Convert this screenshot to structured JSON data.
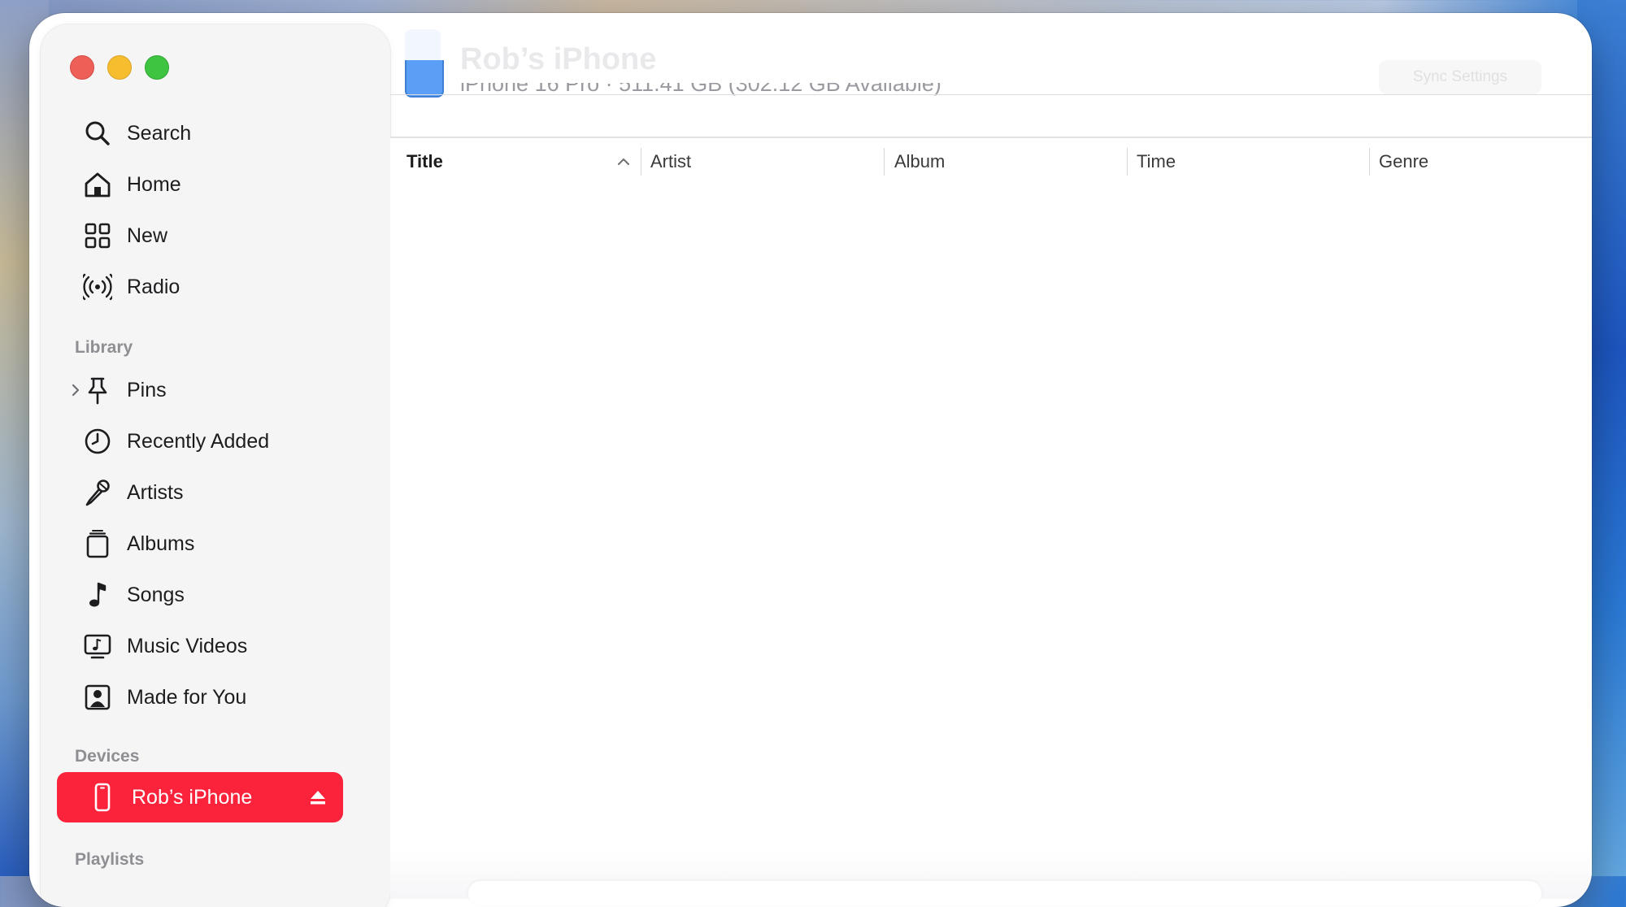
{
  "window": {
    "traffic_lights": [
      "close",
      "minimize",
      "zoom"
    ]
  },
  "sidebar": {
    "nav": [
      {
        "label": "Search",
        "icon": "search-icon"
      },
      {
        "label": "Home",
        "icon": "home-icon"
      },
      {
        "label": "New",
        "icon": "grid-icon"
      },
      {
        "label": "Radio",
        "icon": "radio-icon"
      }
    ],
    "library_title": "Library",
    "library": [
      {
        "label": "Pins",
        "icon": "pin-icon"
      },
      {
        "label": "Recently Added",
        "icon": "clock-icon"
      },
      {
        "label": "Artists",
        "icon": "microphone-icon"
      },
      {
        "label": "Albums",
        "icon": "album-icon"
      },
      {
        "label": "Songs",
        "icon": "music-note-icon"
      },
      {
        "label": "Music Videos",
        "icon": "music-video-icon"
      },
      {
        "label": "Made for You",
        "icon": "person-square-icon"
      }
    ],
    "devices_title": "Devices",
    "device": {
      "label": "Rob’s iPhone",
      "icon": "iphone-icon",
      "accent": "#fa233b"
    },
    "playlists_title": "Playlists"
  },
  "header": {
    "device_name": "Rob’s iPhone",
    "device_info": "iPhone 16 Pro · 511.41 GB (302.12 GB Available)",
    "button_label": "Sync Settings"
  },
  "table": {
    "columns": [
      "Title",
      "Artist",
      "Album",
      "Time",
      "Genre"
    ],
    "sorted_by": "Title",
    "sort_direction": "ascending",
    "rows": []
  }
}
